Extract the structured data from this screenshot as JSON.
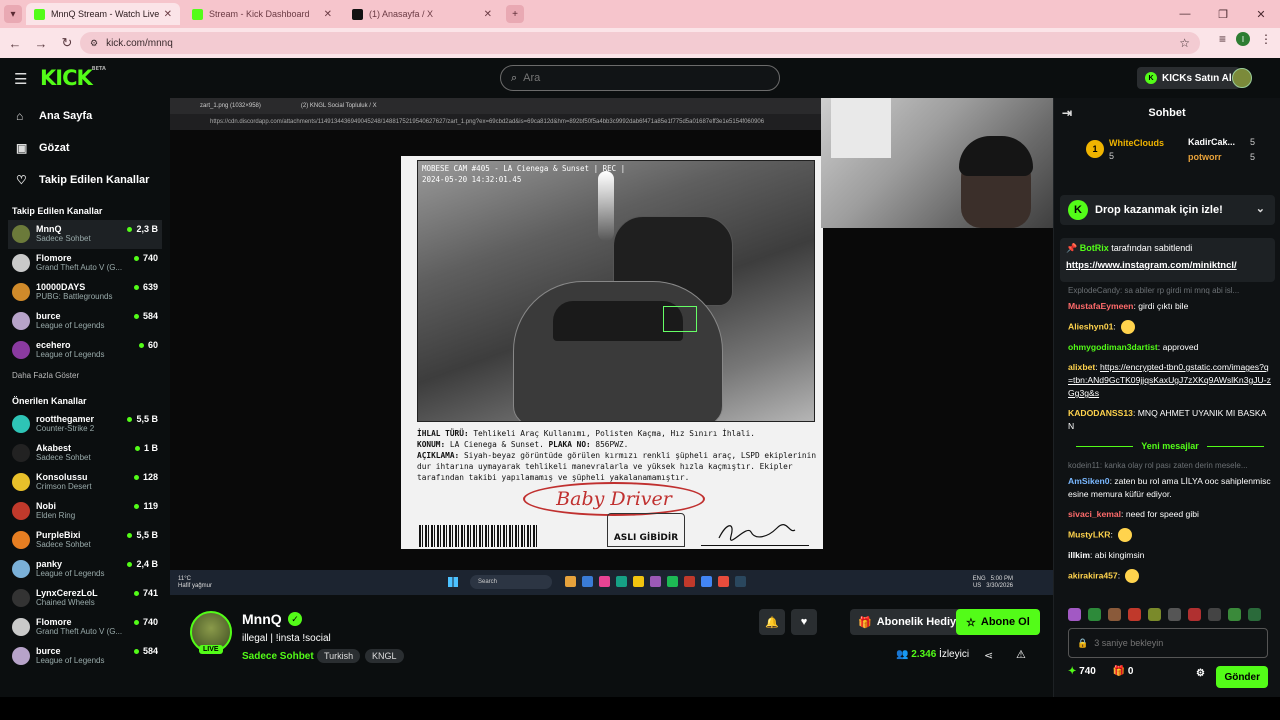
{
  "browser": {
    "tabs": [
      {
        "label": "MnnQ Stream - Watch Live",
        "active": true
      },
      {
        "label": "Stream - Kick Dashboard",
        "active": false
      },
      {
        "label": "(1) Anasayfa / X",
        "active": false
      }
    ],
    "url": "kick.com/mnnq"
  },
  "header": {
    "logo": "KICK",
    "logo_badge": "BETA",
    "search_placeholder": "Ara",
    "kicks_button": "KICKs Satın Al"
  },
  "sidebar": {
    "menu": [
      {
        "label": "Ana Sayfa",
        "icon": "home-icon"
      },
      {
        "label": "Gözat",
        "icon": "browse-icon"
      },
      {
        "label": "Takip Edilen Kanallar",
        "icon": "heart-icon"
      }
    ],
    "followed_title": "Takip Edilen Kanallar",
    "followed": [
      {
        "name": "MnnQ",
        "category": "Sadece Sohbet",
        "viewers": "2,3 B",
        "color": "#6b7a3a"
      },
      {
        "name": "Flomore",
        "category": "Grand Theft Auto V (G...",
        "viewers": "740",
        "color": "#c9c9c9"
      },
      {
        "name": "10000DAYS",
        "category": "PUBG: Battlegrounds",
        "viewers": "639",
        "color": "#d08a2a"
      },
      {
        "name": "burce",
        "category": "League of Legends",
        "viewers": "584",
        "color": "#b7a3c9"
      },
      {
        "name": "ecehero",
        "category": "League of Legends",
        "viewers": "60",
        "color": "#8a3aa0"
      }
    ],
    "show_more": "Daha Fazla Göster",
    "recommended_title": "Önerilen Kanallar",
    "recommended": [
      {
        "name": "rootthegamer",
        "category": "Counter-Strike 2",
        "viewers": "5,5 B",
        "color": "#2ec4b6"
      },
      {
        "name": "Akabest",
        "category": "Sadece Sohbet",
        "viewers": "1 B",
        "color": "#222"
      },
      {
        "name": "Konsolussu",
        "category": "Crimson Desert",
        "viewers": "128",
        "color": "#e8c02a"
      },
      {
        "name": "Nobi",
        "category": "Elden Ring",
        "viewers": "119",
        "color": "#c0392b"
      },
      {
        "name": "PurpleBixi",
        "category": "Sadece Sohbet",
        "viewers": "5,5 B",
        "color": "#e67e22"
      },
      {
        "name": "panky",
        "category": "League of Legends",
        "viewers": "2,4 B",
        "color": "#7ab0d8"
      },
      {
        "name": "LynxCerezLoL",
        "category": "Chained Wheels",
        "viewers": "741",
        "color": "#333"
      },
      {
        "name": "Flomore",
        "category": "Grand Theft Auto V (G...",
        "viewers": "740",
        "color": "#c9c9c9"
      },
      {
        "name": "burce",
        "category": "League of Legends",
        "viewers": "584",
        "color": "#b7a3c9"
      }
    ]
  },
  "player": {
    "inner_tabs": [
      "zart_1.png (1032×958)",
      "(2) KNGL Social Topluluk / X"
    ],
    "inner_url": "https://cdn.discordapp.com/attachments/1149134436949045248/1488175219540627627/zart_1.png?ex=69cbd2ad&is=69ca812d&hm=892bf50f5a4bb3c9992dab6f471a85e1f775d5a01687eff3e1e5154f060906",
    "hud_line1": "MOBESE CAM #405 - LA Cienega & Sunset | REC |",
    "hud_line2": "2024-05-20 14:32:01.45",
    "doc_ihlal_label": "İHLAL TÜRÜ:",
    "doc_ihlal": "Tehlikeli Araç Kullanımı, Polisten Kaçma, Hız Sınırı İhlali.",
    "doc_konum_label": "KONUM:",
    "doc_konum": "LA Cienega & Sunset.",
    "doc_plaka_label": "PLAKA NO:",
    "doc_plaka": "856PWZ.",
    "doc_aciklama_label": "AÇIKLAMA:",
    "doc_aciklama": "Siyah-beyaz görüntüde görülen kırmızı renkli şüpheli araç, LSPD ekiplerinin dur ihtarına uymayarak tehlikeli manevralarla ve yüksek hızla kaçmıştır. Ekipler tarafından takibi yapılamamış ve şüpheli yakalanamamıştır.",
    "stamp": "Baby Driver",
    "seal": "ASLI GİBİDİR",
    "weather_temp": "11°C",
    "weather_desc": "Hafif yağmur",
    "taskbar_search": "Search",
    "lang": "ENG",
    "lang2": "US",
    "time": "5:00 PM",
    "date": "3/30/2026"
  },
  "stream": {
    "name": "MnnQ",
    "title": "illegal | !insta !social",
    "category": "Sadece Sohbet",
    "tags": [
      "Turkish",
      "KNGL"
    ],
    "live": "LIVE",
    "gift_button": "Abonelik Hediye Et",
    "subscribe_button": "Abone Ol",
    "viewers": "2.346",
    "viewers_label": "İzleyici"
  },
  "chat": {
    "title": "Sohbet",
    "leaderboard": [
      {
        "name": "WhiteClouds",
        "count": "5",
        "color": "#f0b400"
      },
      {
        "name": "KadirCak...",
        "count": "5",
        "color": "#fff"
      },
      {
        "name": "potworr",
        "count": "5",
        "color": "#e8a23a"
      }
    ],
    "drop_banner": "Drop kazanmak için izle!",
    "pinned_by": "BotRix",
    "pinned_suffix": "tarafından sabitlendi",
    "pinned_link": "https://www.instagram.com/miniktncl/",
    "faded1": "ExplodeCandy: sa abiler rp girdi mi mnq abi isl...",
    "messages": [
      {
        "user": "MustafaEymeen",
        "color": "#ff6b6b",
        "text": "girdi çıktı bile"
      },
      {
        "user": "Alieshyn01",
        "color": "#ffd34d",
        "text": ""
      },
      {
        "user": "ohmygodiman3dartist",
        "color": "#53fc18",
        "text": "approved"
      },
      {
        "user": "alixbet",
        "color": "#ffd34d",
        "text": "https://encrypted-tbn0.gstatic.com/images?q=tbn:ANd9GcTK09jjqsKaxUgJ7zXKq9AWslKn3gJU-zGg3g&s"
      },
      {
        "user": "KADODANSS13",
        "color": "#ffd34d",
        "text": "MNQ AHMET UYANIK MI BASKAN"
      }
    ],
    "new_messages": "Yeni mesajlar",
    "faded2": "kodein11: kanka olay rol pası zaten derin mesele...",
    "messages2": [
      {
        "user": "AmSiken0",
        "color": "#7ab8ff",
        "text": "zaten bu rol ama LİLYA ooc sahiplenmiscesine memura küfür ediyor."
      },
      {
        "user": "sivaci_kemal",
        "color": "#ff6b6b",
        "text": "need for speed gibi"
      },
      {
        "user": "MustyLKR",
        "color": "#ffd34d",
        "text": ""
      },
      {
        "user": "illkim",
        "color": "#fff",
        "text": "abi kingimsin"
      },
      {
        "user": "akirakira457",
        "color": "#ffd34d",
        "text": ""
      }
    ],
    "input_placeholder": "3 saniye bekleyin",
    "kicks_count": "740",
    "gift_count": "0",
    "send_button": "Gönder"
  }
}
